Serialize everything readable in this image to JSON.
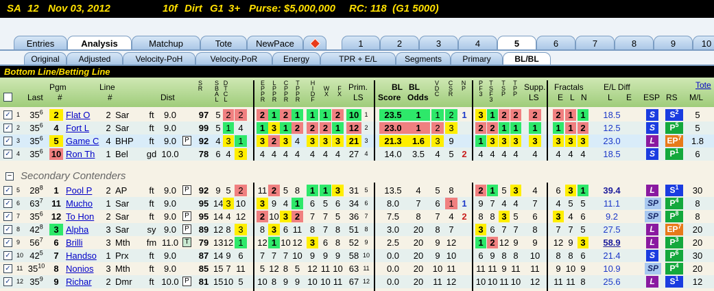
{
  "race_header": {
    "track": "SA",
    "race": "12",
    "date": "Nov 03, 2012",
    "distance": "10f",
    "surface": "Dirt",
    "grade": "G1",
    "age": "3+",
    "purse": "Purse: $5,000,000",
    "rc": "RC: 118  (G1 5000)"
  },
  "main_tabs": [
    "Entries",
    "Analysis",
    "Matchup",
    "Tote",
    "NewPace",
    "1",
    "2",
    "3",
    "4",
    "5",
    "6",
    "7",
    "8",
    "9",
    "10"
  ],
  "sub_tabs": [
    "Original",
    "Adjusted",
    "Velocity-PoH",
    "Velocity-PoR",
    "Energy",
    "TPR + E/L",
    "Segments",
    "Primary",
    "BL/BL"
  ],
  "section_title": "Bottom Line/Betting Line",
  "secondary_label": "Secondary Contenders",
  "headers": {
    "last": "Last",
    "pgm": "Pgm",
    "pgm_hash": "#",
    "line": "Line",
    "line_hash": "#",
    "dist": "Dist",
    "sbal": "S B A L",
    "dtcl": "D T C L",
    "epp": "E P P R",
    "lppr": "L P P R",
    "cppr": "C P P R",
    "tppr": "T P P R",
    "hidf": "H I D F",
    "wx": "W X",
    "fx": "F X",
    "prim": "Prim.",
    "ls": "LS",
    "bl_score": "BL Score",
    "bl_odds": "BL Odds",
    "vdc": "V D C",
    "csr": "C S R",
    "np": "N P",
    "pf3": "P F 3",
    "tsf3": "T S F3",
    "tsp": "T S P",
    "psp": "P P",
    "supp": "Supp.",
    "fractals": "Fractals",
    "e": "E",
    "l": "L",
    "n": "N",
    "el": "E/L Diff",
    "elL": "L",
    "elE": "E",
    "esp": "ESP",
    "rs": "RS",
    "tote": "Tote",
    "ml": "M/L"
  },
  "rows": [
    {
      "n": "1",
      "last": "35",
      "lsup": "6",
      "pgm": "2",
      "name": "Flat O",
      "line": "2",
      "trk": "Sar",
      "surf": "ft",
      "dist": "9.0",
      "p": "",
      "sr": "97",
      "a": "5",
      "b": "2",
      "c": "2",
      "e1": "2",
      "e2": "1",
      "e3": "2",
      "e4": "1",
      "e5": "1",
      "e6": "1",
      "e7": "2",
      "prim": "10",
      "ps": "1",
      "bls": "23.5",
      "blo": "1",
      "vdc": "1",
      "csr": "2",
      "np": "1",
      "f1": "3",
      "f2": "1",
      "f3": "2",
      "f4": "2",
      "supp": "2",
      "fe": "2",
      "fl": "1",
      "fn": "1",
      "el": "18.5",
      "esp": "S",
      "rs": "S",
      "rss": "2",
      "ml": "5"
    },
    {
      "n": "2",
      "last": "35",
      "lsup": "6",
      "pgm": "4",
      "name": "Fort L",
      "line": "2",
      "trk": "Sar",
      "surf": "ft",
      "dist": "9.0",
      "p": "",
      "sr": "99",
      "a": "5",
      "b": "1",
      "c": "4",
      "e1": "1",
      "e2": "3",
      "e3": "1",
      "e4": "2",
      "e5": "2",
      "e6": "2",
      "e7": "1",
      "prim": "12",
      "ps": "2",
      "bls": "23.0",
      "blo": "1",
      "vdc": "2",
      "csr": "3",
      "np": "",
      "f1": "2",
      "f2": "2",
      "f3": "1",
      "f4": "1",
      "supp": "1",
      "fe": "1",
      "fl": "1",
      "fn": "2",
      "el": "12.5",
      "esp": "S",
      "rs": "P",
      "rss": "5",
      "ml": "5"
    },
    {
      "n": "3",
      "last": "35",
      "lsup": "6",
      "pgm": "5",
      "name": "Game C",
      "line": "4",
      "trk": "BHP",
      "surf": "ft",
      "dist": "9.0",
      "p": "P",
      "sr": "92",
      "a": "4",
      "b": "3",
      "c": "1",
      "e1": "3",
      "e2": "2",
      "e3": "3",
      "e4": "4",
      "e5": "3",
      "e6": "3",
      "e7": "3",
      "prim": "21",
      "ps": "3",
      "bls": "21.3",
      "blo": "1.6",
      "vdc": "3",
      "csr": "9",
      "np": "",
      "f1": "1",
      "f2": "3",
      "f3": "3",
      "f4": "3",
      "supp": "3",
      "fe": "3",
      "fl": "3",
      "fn": "3",
      "el": "23.0",
      "esp": "L",
      "rs": "EP",
      "rss": "7",
      "ml": "1.8"
    },
    {
      "n": "4",
      "last": "35",
      "lsup": "6",
      "pgm": "10",
      "name": "Ron Th",
      "line": "1",
      "trk": "Bel",
      "surf": "gd",
      "dist": "10.0",
      "p": "",
      "sr": "78",
      "a": "6",
      "b": "4",
      "c": "3",
      "e1": "4",
      "e2": "4",
      "e3": "4",
      "e4": "4",
      "e5": "4",
      "e6": "4",
      "e7": "4",
      "prim": "27",
      "ps": "4",
      "bls": "14.0",
      "blo": "3.5",
      "vdc": "4",
      "csr": "5",
      "np": "2",
      "f1": "4",
      "f2": "4",
      "f3": "4",
      "f4": "4",
      "supp": "4",
      "fe": "4",
      "fl": "4",
      "fn": "4",
      "el": "18.5",
      "esp": "S",
      "rs": "P",
      "rss": "1",
      "ml": "6"
    },
    {
      "n": "5",
      "last": "28",
      "lsup": "8",
      "pgm": "1",
      "name": "Pool P",
      "line": "2",
      "trk": "AP",
      "surf": "ft",
      "dist": "9.0",
      "p": "P",
      "sr": "92",
      "a": "9",
      "b": "5",
      "c": "2",
      "e1": "11",
      "e2": "2",
      "e3": "5",
      "e4": "8",
      "e5": "1",
      "e6": "1",
      "e7": "3",
      "prim": "31",
      "ps": "5",
      "bls": "13.5",
      "blo": "4",
      "vdc": "5",
      "csr": "8",
      "np": "",
      "f1": "2",
      "f2": "1",
      "f3": "5",
      "f4": "3",
      "supp": "4",
      "fe": "6",
      "fl": "3",
      "fn": "1",
      "el": "39.4",
      "esp": "L",
      "rs": "S",
      "rss": "1",
      "ml": "30"
    },
    {
      "n": "6",
      "last": "63",
      "lsup": "7",
      "pgm": "11",
      "name": "Mucho",
      "line": "1",
      "trk": "Sar",
      "surf": "ft",
      "dist": "9.0",
      "p": "",
      "sr": "95",
      "a": "14",
      "b": "3",
      "c": "10",
      "e1": "3",
      "e2": "9",
      "e3": "4",
      "e4": "1",
      "e5": "6",
      "e6": "5",
      "e7": "6",
      "prim": "34",
      "ps": "6",
      "bls": "8.0",
      "blo": "7",
      "vdc": "6",
      "csr": "1",
      "np": "1",
      "f1": "9",
      "f2": "7",
      "f3": "4",
      "f4": "4",
      "supp": "7",
      "fe": "4",
      "fl": "5",
      "fn": "5",
      "el": "11.1",
      "esp": "SP",
      "rs": "P",
      "rss": "4",
      "ml": "8"
    },
    {
      "n": "7",
      "last": "35",
      "lsup": "6",
      "pgm": "12",
      "name": "To Hon",
      "line": "2",
      "trk": "Sar",
      "surf": "ft",
      "dist": "9.0",
      "p": "P",
      "sr": "95",
      "a": "14",
      "b": "4",
      "c": "12",
      "e1": "2",
      "e2": "10",
      "e3": "3",
      "e4": "2",
      "e5": "7",
      "e6": "7",
      "e7": "5",
      "prim": "36",
      "ps": "7",
      "bls": "7.5",
      "blo": "8",
      "vdc": "7",
      "csr": "4",
      "np": "2",
      "f1": "8",
      "f2": "8",
      "f3": "3",
      "f4": "5",
      "supp": "6",
      "fe": "3",
      "fl": "4",
      "fn": "6",
      "el": "9.2",
      "esp": "SP",
      "rs": "P",
      "rss": "8",
      "ml": "8"
    },
    {
      "n": "8",
      "last": "42",
      "lsup": "8",
      "pgm": "3",
      "name": "Alpha",
      "line": "3",
      "trk": "Sar",
      "surf": "sy",
      "dist": "9.0",
      "p": "P",
      "sr": "89",
      "a": "12",
      "b": "8",
      "c": "3",
      "e1": "8",
      "e2": "3",
      "e3": "6",
      "e4": "11",
      "e5": "8",
      "e6": "7",
      "e7": "8",
      "prim": "51",
      "ps": "8",
      "bls": "3.0",
      "blo": "20",
      "vdc": "8",
      "csr": "7",
      "np": "",
      "f1": "3",
      "f2": "6",
      "f3": "7",
      "f4": "7",
      "supp": "8",
      "fe": "7",
      "fl": "7",
      "fn": "5",
      "el": "27.5",
      "esp": "L",
      "rs": "EP",
      "rss": "7",
      "ml": "20"
    },
    {
      "n": "9",
      "last": "56",
      "lsup": "7",
      "pgm": "6",
      "name": "Brilli",
      "line": "3",
      "trk": "Mth",
      "surf": "fm",
      "dist": "11.0",
      "p": "T",
      "sr": "79",
      "a": "13",
      "b": "12",
      "c": "1",
      "e1": "12",
      "e2": "1",
      "e3": "10",
      "e4": "12",
      "e5": "3",
      "e6": "6",
      "e7": "8",
      "prim": "52",
      "ps": "9",
      "bls": "2.5",
      "blo": "20",
      "vdc": "9",
      "csr": "12",
      "np": "",
      "f1": "1",
      "f2": "2",
      "f3": "12",
      "f4": "9",
      "supp": "9",
      "fe": "12",
      "fl": "9",
      "fn": "3",
      "el": "58.9",
      "esp": "L",
      "rs": "P",
      "rss": "3",
      "ml": "20"
    },
    {
      "n": "10",
      "last": "42",
      "lsup": "5",
      "pgm": "7",
      "name": "Handso",
      "line": "1",
      "trk": "Prx",
      "surf": "ft",
      "dist": "9.0",
      "p": "",
      "sr": "87",
      "a": "14",
      "b": "9",
      "c": "6",
      "e1": "7",
      "e2": "7",
      "e3": "7",
      "e4": "10",
      "e5": "9",
      "e6": "9",
      "e7": "9",
      "prim": "58",
      "ps": "10",
      "bls": "0.0",
      "blo": "20",
      "vdc": "9",
      "csr": "10",
      "np": "",
      "f1": "6",
      "f2": "9",
      "f3": "8",
      "f4": "8",
      "supp": "10",
      "fe": "8",
      "fl": "8",
      "fn": "6",
      "el": "21.4",
      "esp": "S",
      "rs": "P",
      "rss": "6",
      "ml": "30"
    },
    {
      "n": "11",
      "last": "35",
      "lsup": "10",
      "pgm": "8",
      "name": "Nonios",
      "line": "3",
      "trk": "Mth",
      "surf": "ft",
      "dist": "9.0",
      "p": "",
      "sr": "85",
      "a": "15",
      "b": "7",
      "c": "11",
      "e1": "5",
      "e2": "12",
      "e3": "8",
      "e4": "5",
      "e5": "12",
      "e6": "11",
      "e7": "10",
      "prim": "63",
      "ps": "11",
      "bls": "0.0",
      "blo": "20",
      "vdc": "10",
      "csr": "11",
      "np": "",
      "f1": "11",
      "f2": "11",
      "f3": "9",
      "f4": "11",
      "supp": "11",
      "fe": "9",
      "fl": "10",
      "fn": "9",
      "el": "10.9",
      "esp": "SP",
      "rs": "P",
      "rss": "4",
      "ml": "20"
    },
    {
      "n": "12",
      "last": "35",
      "lsup": "9",
      "pgm": "9",
      "name": "Richar",
      "line": "2",
      "trk": "Dmr",
      "surf": "ft",
      "dist": "10.0",
      "p": "P",
      "sr": "81",
      "a": "15",
      "b": "10",
      "c": "5",
      "e1": "10",
      "e2": "8",
      "e3": "9",
      "e4": "9",
      "e5": "10",
      "e6": "10",
      "e7": "11",
      "prim": "67",
      "ps": "12",
      "bls": "0.0",
      "blo": "20",
      "vdc": "11",
      "csr": "12",
      "np": "",
      "f1": "10",
      "f2": "10",
      "f3": "11",
      "f4": "10",
      "supp": "12",
      "fe": "11",
      "fl": "11",
      "fn": "8",
      "el": "25.6",
      "esp": "L",
      "rs": "S",
      "rss": "1",
      "ml": "12"
    }
  ],
  "colors": {
    "green": "#2ee86a",
    "yellow": "#ffee00",
    "red": "#f08080",
    "esp_S": "#1a3ce0",
    "esp_L": "#8a1aa0",
    "esp_SP": "#a8c8f0",
    "rs_S": "#1a3ce0",
    "rs_P": "#14a83c",
    "rs_EP": "#e87a1a"
  }
}
